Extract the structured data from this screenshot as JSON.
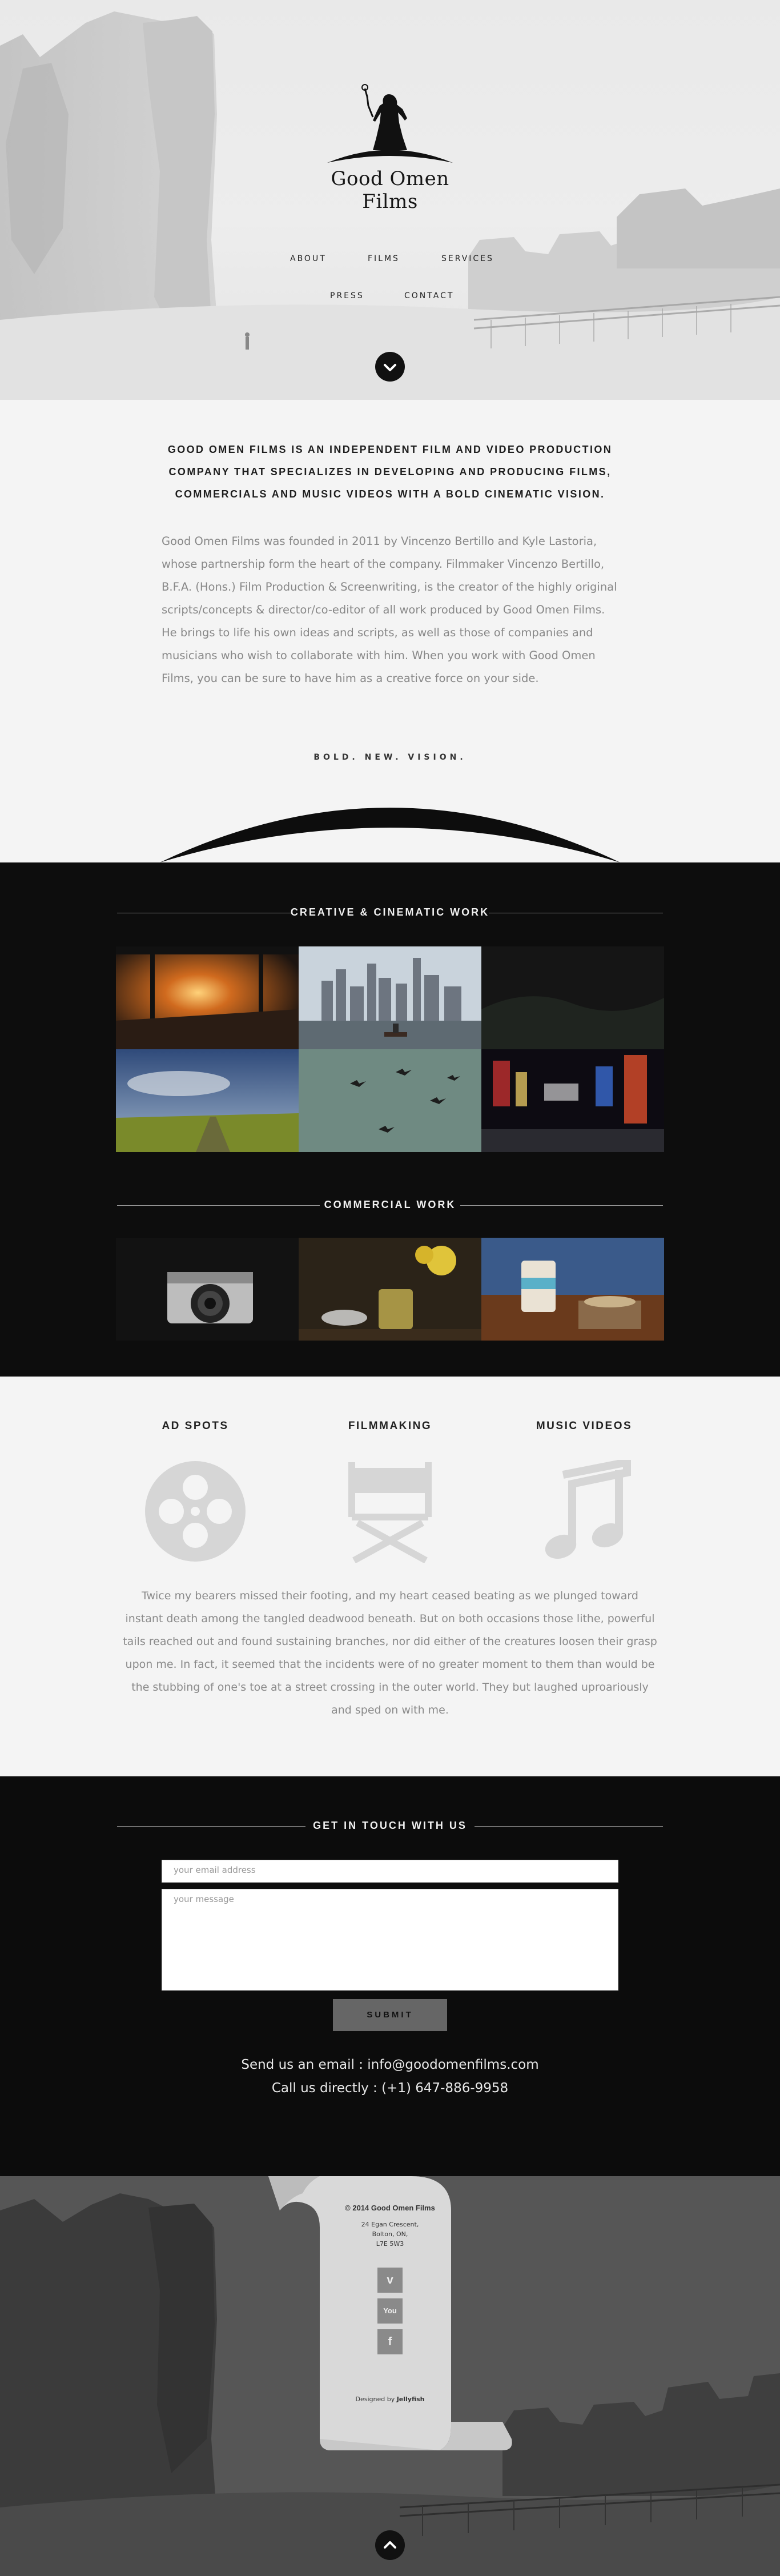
{
  "brand": {
    "name": "Good Omen Films"
  },
  "nav": {
    "about": "ABOUT",
    "films": "FILMS",
    "services": "SERVICES",
    "press": "PRESS",
    "contact": "CONTACT"
  },
  "about": {
    "lead": "GOOD OMEN FILMS IS AN INDEPENDENT FILM AND VIDEO PRODUCTION COMPANY THAT SPECIALIZES IN DEVELOPING AND PRODUCING FILMS, COMMERCIALS AND MUSIC VIDEOS WITH A BOLD CINEMATIC VISION.",
    "body": "Good Omen Films was founded in 2011 by Vincenzo Bertillo and Kyle Lastoria, whose partnership form the heart of the company. Filmmaker Vincenzo Bertillo, B.F.A. (Hons.) Film Production & Screenwriting, is the creator of the highly original scripts/concepts & director/co-editor of all work produced by Good Omen Films. He brings to life his own ideas and scripts, as well as those of companies and musicians who wish to collaborate with him. When you work with Good Omen Films, you can be sure to have him as a creative force on your side.",
    "tagline": "BOLD. NEW. VISION."
  },
  "work": {
    "creative_title": "CREATIVE & CINEMATIC WORK",
    "commercial_title": "COMMERCIAL WORK"
  },
  "services": {
    "ad_spots": "AD SPOTS",
    "filmmaking": "FILMMAKING",
    "music_videos": "MUSIC VIDEOS",
    "text": "Twice my bearers missed their footing, and my heart ceased beating as we plunged toward instant death among the tangled deadwood beneath. But on both occasions those lithe, powerful tails reached out and found sustaining branches, nor did either of the creatures loosen their grasp upon me.  In fact, it seemed that the incidents were of no greater moment to them than would be the stubbing of one's toe at a street crossing in the outer world. They but laughed uproariously and sped on with me."
  },
  "contact": {
    "title": "GET IN TOUCH WITH US",
    "email_placeholder": "your email address",
    "message_placeholder": "your message",
    "submit": "SUBMIT",
    "email_line": "Send us an email :   info@goodomenfilms.com",
    "phone_line": "Call us directly :   (+1) 647-886-9958"
  },
  "footer": {
    "copyright": "© 2014 Good Omen Films",
    "address_line1": "24 Egan Crescent,",
    "address_line2": "Bolton, ON,",
    "address_line3": "L7E 5W3",
    "vimeo_icon": "v",
    "youtube_icon": "You",
    "facebook_icon": "f",
    "designed_by_prefix": "Designed by ",
    "designed_by": "Jellyfish"
  },
  "colors": {
    "dark": "#0d0d0d",
    "light": "#f4f4f4",
    "text_gray": "#888888"
  }
}
